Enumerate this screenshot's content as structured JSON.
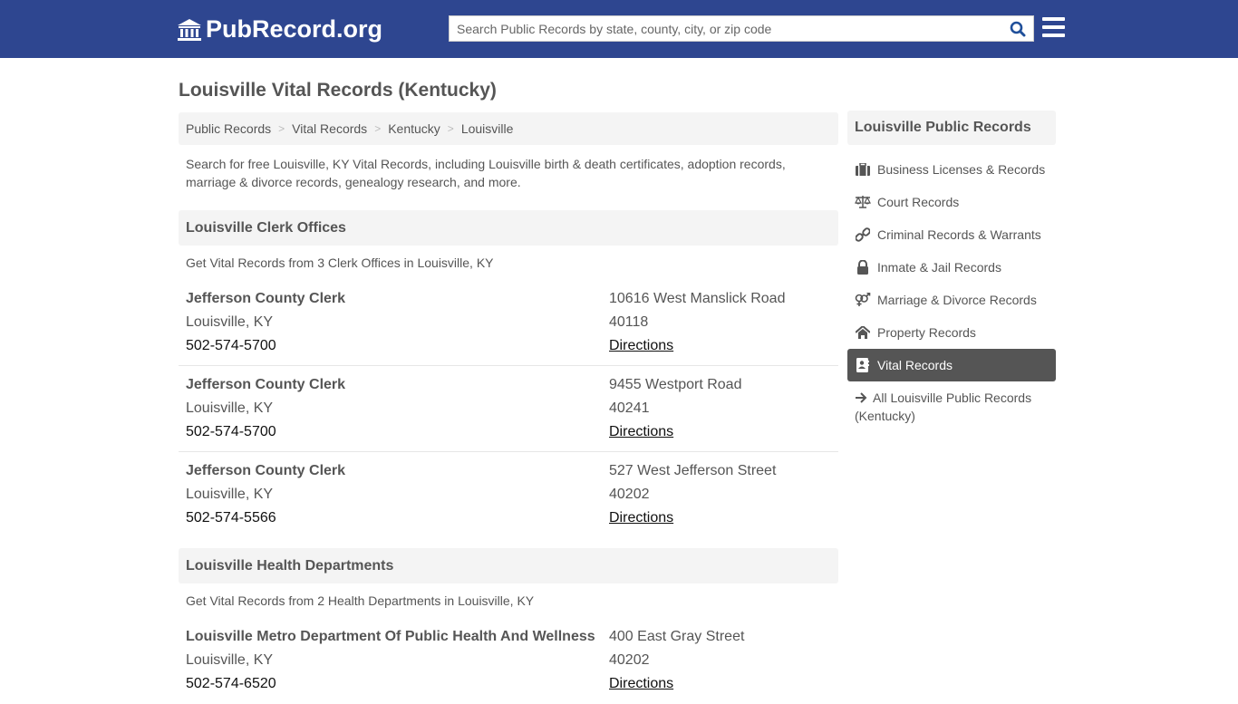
{
  "header": {
    "logo_text": "PubRecord.org",
    "search_placeholder": "Search Public Records by state, county, city, or zip code",
    "search_value": "",
    "colors": {
      "brand": "#2e4690",
      "search_icon": "#1f4f9a"
    }
  },
  "page": {
    "title": "Louisville Vital Records (Kentucky)",
    "breadcrumb": [
      "Public Records",
      "Vital Records",
      "Kentucky",
      "Louisville"
    ],
    "intro": "Search for free Louisville, KY Vital Records, including Louisville birth & death certificates, adoption records, marriage & divorce records, genealogy research, and more."
  },
  "sections": [
    {
      "title": "Louisville Clerk Offices",
      "subtitle": "Get Vital Records from 3 Clerk Offices in Louisville, KY",
      "entries": [
        {
          "name": "Jefferson County Clerk",
          "city": "Louisville, KY",
          "phone": "502-574-5700",
          "address": "10616 West Manslick Road",
          "zip": "40118",
          "directions": "Directions"
        },
        {
          "name": "Jefferson County Clerk",
          "city": "Louisville, KY",
          "phone": "502-574-5700",
          "address": "9455 Westport Road",
          "zip": "40241",
          "directions": "Directions"
        },
        {
          "name": "Jefferson County Clerk",
          "city": "Louisville, KY",
          "phone": "502-574-5566",
          "address": "527 West Jefferson Street",
          "zip": "40202",
          "directions": "Directions"
        }
      ]
    },
    {
      "title": "Louisville Health Departments",
      "subtitle": "Get Vital Records from 2 Health Departments in Louisville, KY",
      "entries": [
        {
          "name": "Louisville Metro Department Of Public Health And Wellness",
          "city": "Louisville, KY",
          "phone": "502-574-6520",
          "address": "400 East Gray Street",
          "zip": "40202",
          "directions": "Directions"
        }
      ]
    }
  ],
  "sidebar": {
    "title": "Louisville Public Records",
    "items": [
      {
        "label": "Business Licenses & Records",
        "icon": "briefcase-icon"
      },
      {
        "label": "Court Records",
        "icon": "scales-icon"
      },
      {
        "label": "Criminal Records & Warrants",
        "icon": "link-icon"
      },
      {
        "label": "Inmate & Jail Records",
        "icon": "lock-icon"
      },
      {
        "label": "Marriage & Divorce Records",
        "icon": "venus-mars-icon"
      },
      {
        "label": "Property Records",
        "icon": "home-icon"
      },
      {
        "label": "Vital Records",
        "icon": "address-card-icon",
        "active": true
      }
    ],
    "all_link": "All Louisville Public Records (Kentucky)"
  }
}
